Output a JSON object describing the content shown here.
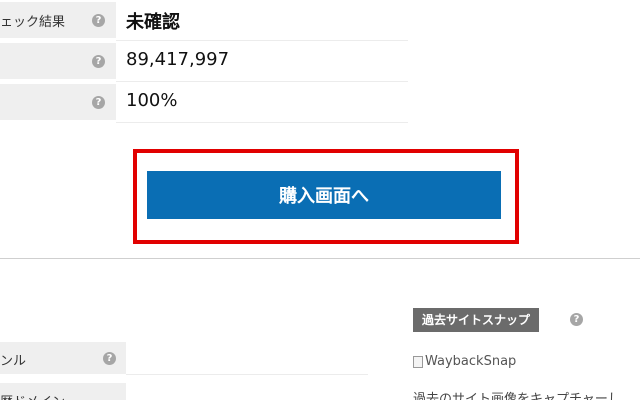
{
  "info_rows": [
    {
      "label": "ェック結果",
      "value": "未確認"
    },
    {
      "label": "",
      "value": "89,417,997"
    },
    {
      "label": "",
      "value": "100%"
    }
  ],
  "help_glyph": "?",
  "purchase": {
    "label": "購入画面へ",
    "color": "#0a6eb4",
    "highlight_color": "#e10000"
  },
  "lower_rows": [
    {
      "label": "ンル"
    },
    {
      "label": "歴ドメイン"
    }
  ],
  "snapshot": {
    "badge": "過去サイトスナップ",
    "image_alt": "WaybackSnap",
    "description": "過去のサイト画像をキャプチャーし"
  }
}
